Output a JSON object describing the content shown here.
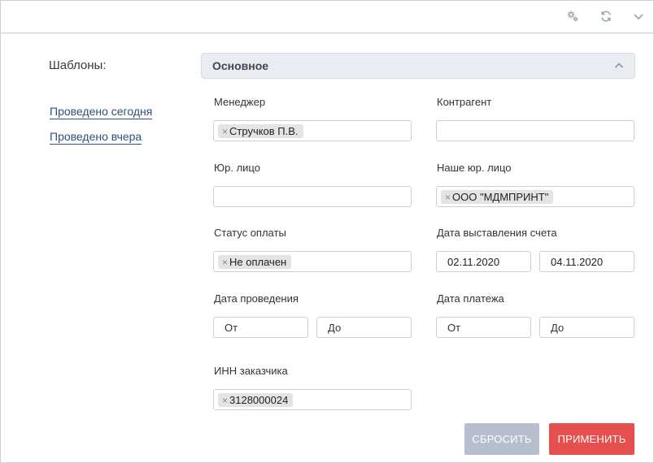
{
  "toolbar": {
    "icons": [
      "settings-gears-icon",
      "refresh-icon",
      "chevron-down-icon"
    ]
  },
  "templates": {
    "label": "Шаблоны:",
    "links": [
      "Проведено сегодня",
      "Проведено вчера"
    ]
  },
  "section": {
    "title": "Основное"
  },
  "fields": {
    "manager": {
      "label": "Менеджер",
      "tags": [
        "Стручков П.В."
      ]
    },
    "counterparty": {
      "label": "Контрагент",
      "value": ""
    },
    "legal_entity": {
      "label": "Юр. лицо",
      "value": ""
    },
    "our_legal_entity": {
      "label": "Наше юр. лицо",
      "tags": [
        "ООО \"МДМПРИНТ\""
      ]
    },
    "payment_status": {
      "label": "Статус оплаты",
      "tags": [
        "Не оплачен"
      ]
    },
    "invoice_date": {
      "label": "Дата выставления счета",
      "from": "02.11.2020",
      "to": "04.11.2020"
    },
    "posting_date": {
      "label": "Дата проведения",
      "from_placeholder": "От",
      "to_placeholder": "До"
    },
    "payment_date": {
      "label": "Дата платежа",
      "from_placeholder": "От",
      "to_placeholder": "До"
    },
    "customer_inn": {
      "label": "ИНН заказчика",
      "tags": [
        "3128000024"
      ]
    }
  },
  "buttons": {
    "reset": "СБРОСИТЬ",
    "apply": "ПРИМЕНИТЬ"
  },
  "colors": {
    "apply": "#e5504f",
    "reset": "#b7bece",
    "link": "#2f4f7a",
    "header_bg": "#e9ecf0"
  }
}
